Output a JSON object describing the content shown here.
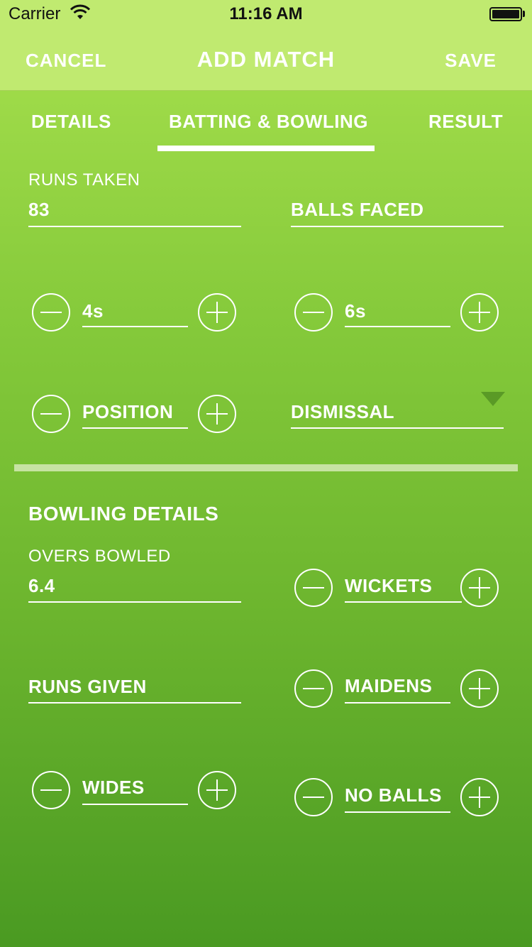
{
  "status_bar": {
    "carrier": "Carrier",
    "time": "11:16 AM"
  },
  "nav": {
    "cancel": "CANCEL",
    "title": "ADD MATCH",
    "save": "SAVE"
  },
  "tabs": [
    {
      "label": "DETAILS",
      "active": false
    },
    {
      "label": "BATTING & BOWLING",
      "active": true
    },
    {
      "label": "RESULT",
      "active": false
    }
  ],
  "batting": {
    "runs_taken": {
      "label": "RUNS TAKEN",
      "value": "83"
    },
    "balls_faced": {
      "placeholder": "BALLS FACED"
    },
    "fours": {
      "placeholder": "4s"
    },
    "sixes": {
      "placeholder": "6s"
    },
    "position": {
      "placeholder": "POSITION"
    },
    "dismissal": {
      "placeholder": "DISMISSAL"
    }
  },
  "bowling": {
    "title": "BOWLING DETAILS",
    "overs_bowled": {
      "label": "OVERS BOWLED",
      "value": "6.4"
    },
    "wickets": {
      "placeholder": "WICKETS"
    },
    "runs_given": {
      "placeholder": "RUNS GIVEN"
    },
    "maidens": {
      "placeholder": "MAIDENS"
    },
    "wides": {
      "placeholder": "WIDES"
    },
    "no_balls": {
      "placeholder": "NO BALLS"
    }
  },
  "colors": {
    "nav_bg": "#c0ea70",
    "gradient_top": "#a8e14e",
    "gradient_bottom": "#4a9a22"
  },
  "icons": [
    "wifi-icon",
    "battery-icon",
    "minus-circle-icon",
    "plus-circle-icon",
    "dropdown-arrow-icon"
  ]
}
